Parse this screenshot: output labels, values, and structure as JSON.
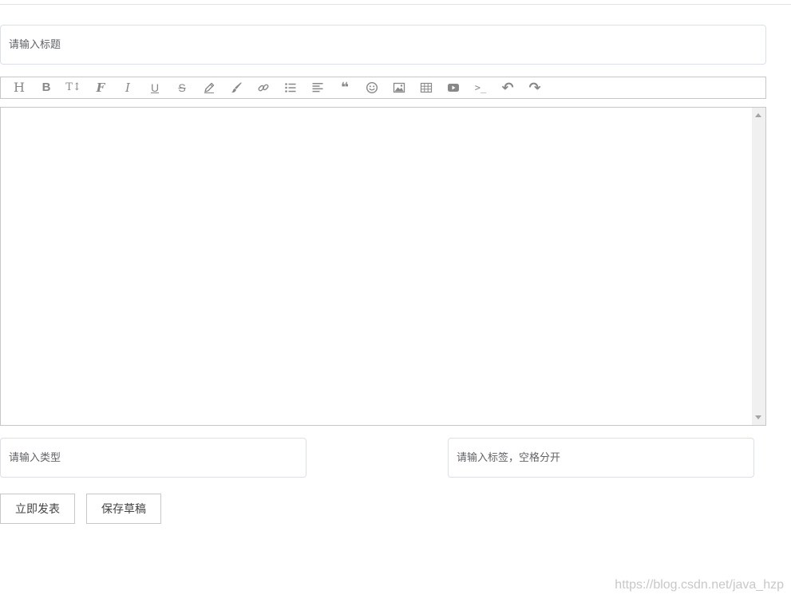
{
  "form": {
    "title_placeholder": "请输入标题",
    "title_value": "",
    "type_placeholder": "请输入类型",
    "type_value": "",
    "tags_placeholder": "请输入标签，空格分开",
    "tags_value": "",
    "editor_content": ""
  },
  "toolbar": {
    "items": [
      {
        "name": "heading",
        "icon": "heading-icon",
        "glyph": "H"
      },
      {
        "name": "bold",
        "icon": "bold-icon",
        "glyph": "B"
      },
      {
        "name": "font-size",
        "icon": "font-size-icon",
        "glyph": "T↕"
      },
      {
        "name": "font-family",
        "icon": "font-icon",
        "glyph": "F"
      },
      {
        "name": "italic",
        "icon": "italic-icon",
        "glyph": "I"
      },
      {
        "name": "underline",
        "icon": "underline-icon",
        "glyph": "U"
      },
      {
        "name": "strikethrough",
        "icon": "strikethrough-icon",
        "glyph": "S"
      },
      {
        "name": "text-color",
        "icon": "pencil-icon",
        "glyph": ""
      },
      {
        "name": "background-color",
        "icon": "paint-brush-icon",
        "glyph": ""
      },
      {
        "name": "link",
        "icon": "link-icon",
        "glyph": ""
      },
      {
        "name": "list",
        "icon": "list-icon",
        "glyph": ""
      },
      {
        "name": "justify",
        "icon": "align-left-icon",
        "glyph": ""
      },
      {
        "name": "quote",
        "icon": "quote-icon",
        "glyph": "❝"
      },
      {
        "name": "emoticon",
        "icon": "smiley-icon",
        "glyph": "☺"
      },
      {
        "name": "image",
        "icon": "image-icon",
        "glyph": ""
      },
      {
        "name": "table",
        "icon": "table-icon",
        "glyph": ""
      },
      {
        "name": "video",
        "icon": "video-icon",
        "glyph": ""
      },
      {
        "name": "code",
        "icon": "terminal-icon",
        "glyph": ">_"
      },
      {
        "name": "undo",
        "icon": "undo-icon",
        "glyph": "↶"
      },
      {
        "name": "redo",
        "icon": "redo-icon",
        "glyph": "↷"
      }
    ]
  },
  "buttons": {
    "publish_label": "立即发表",
    "draft_label": "保存草稿"
  },
  "watermark": "https://blog.csdn.net/java_hzp",
  "colors": {
    "border": "#c7c7c7",
    "input_border": "#dcdfe6",
    "icon": "#888888",
    "scrollbar_track": "#f0f0f0"
  }
}
